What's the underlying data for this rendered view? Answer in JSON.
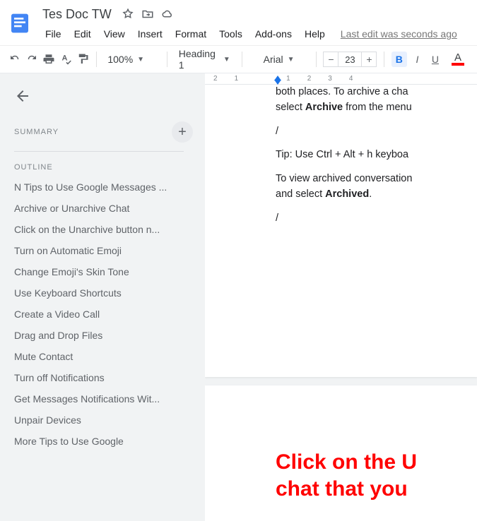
{
  "header": {
    "doc_title": "Tes Doc TW",
    "last_edit": "Last edit was seconds ago"
  },
  "menu": {
    "file": "File",
    "edit": "Edit",
    "view": "View",
    "insert": "Insert",
    "format": "Format",
    "tools": "Tools",
    "addons": "Add-ons",
    "help": "Help"
  },
  "toolbar": {
    "zoom": "100%",
    "style": "Heading 1",
    "font": "Arial",
    "font_size": "23"
  },
  "outline": {
    "summary_label": "SUMMARY",
    "outline_label": "OUTLINE",
    "items": [
      "N Tips to Use Google Messages ...",
      "Archive or Unarchive Chat",
      "Click on the Unarchive button n...",
      "Turn on Automatic Emoji",
      "Change Emoji's Skin Tone",
      "Use Keyboard Shortcuts",
      "Create a Video Call",
      "Drag and Drop Files",
      "Mute Contact",
      "Turn off Notifications",
      "Get Messages Notifications Wit...",
      "Unpair Devices",
      "More Tips to Use Google"
    ]
  },
  "doc": {
    "p1_pre": "both places. To archive a cha",
    "p1_line1a": "select ",
    "p1_line1b": "Archive",
    "p1_line1c": " from the menu",
    "slash": "/",
    "p2": "Tip: Use Ctrl + Alt + h keyboa",
    "p3a": "To view archived conversation",
    "p3b": "and select ",
    "p3c": "Archived",
    "p3d": ".",
    "h_line1": "Click on the U",
    "h_line2": "chat that you"
  },
  "ruler": {
    "m2": "2",
    "m1a": "1",
    "m1b": "1",
    "m2b": "2",
    "m3": "3",
    "m4": "4"
  }
}
